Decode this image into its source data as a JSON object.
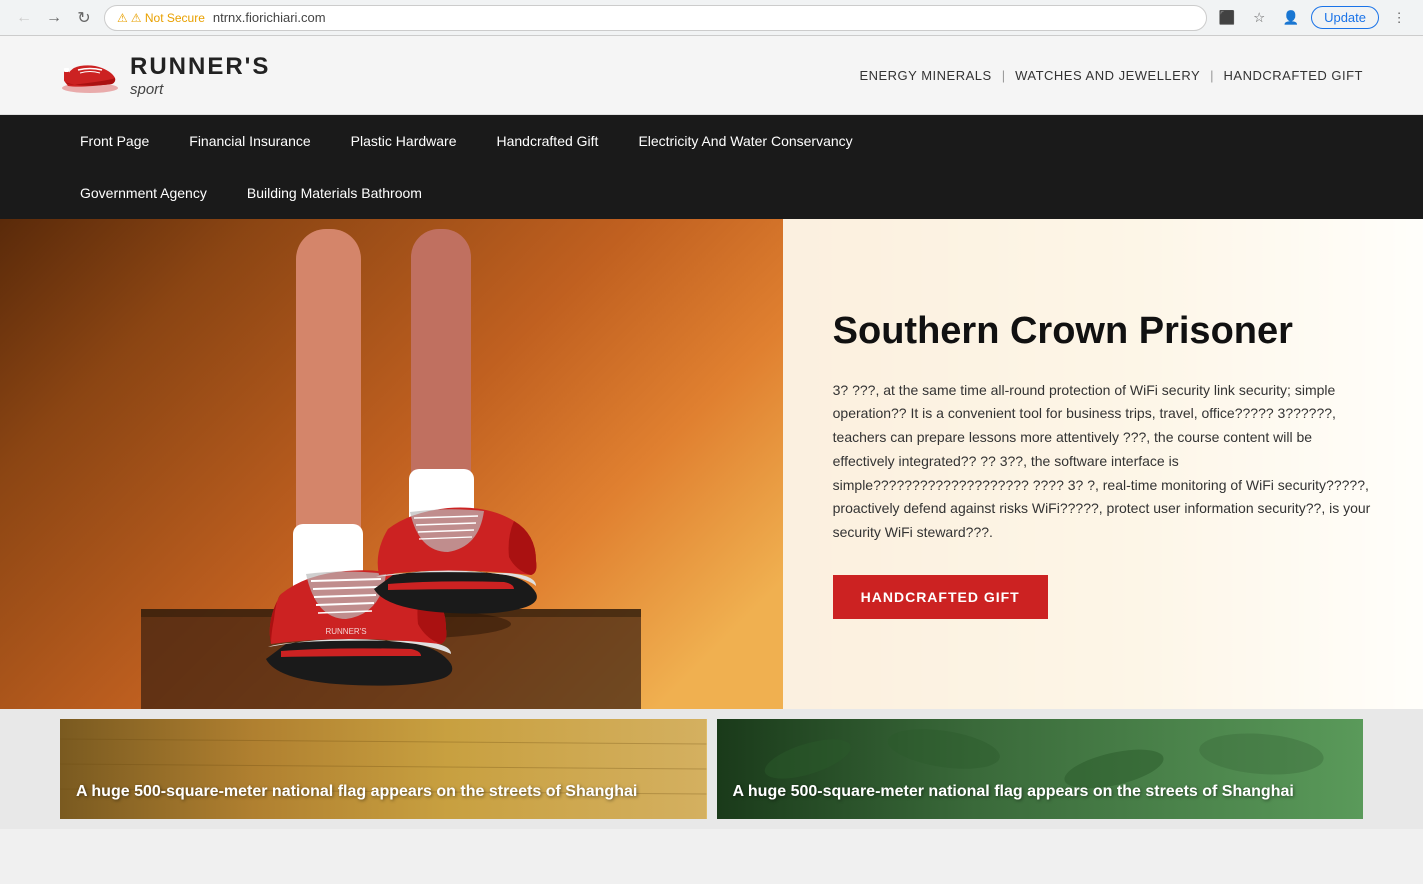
{
  "browser": {
    "back_disabled": true,
    "forward_disabled": false,
    "reload_label": "↻",
    "secure_warning": "⚠ Not Secure",
    "url": "ntrnx.fiorichiari.com",
    "update_label": "Update"
  },
  "site_header": {
    "logo_brand": "RUNNER'S",
    "logo_sub": "sport",
    "nav_items": [
      {
        "label": "ENERGY MINERALS"
      },
      {
        "label": "WATCHES AND JEWELLERY"
      },
      {
        "label": "HANDCRAFTED GIFT"
      }
    ]
  },
  "main_nav": {
    "row1": [
      {
        "label": "Front Page"
      },
      {
        "label": "Financial Insurance"
      },
      {
        "label": "Plastic Hardware"
      },
      {
        "label": "Handcrafted Gift"
      },
      {
        "label": "Electricity And Water Conservancy"
      }
    ],
    "row2": [
      {
        "label": "Government Agency"
      },
      {
        "label": "Building Materials Bathroom"
      }
    ]
  },
  "hero": {
    "title": "Southern Crown Prisoner",
    "description": "3? ???, at the same time all-round protection of WiFi security link security; simple operation?? It is a convenient tool for business trips, travel, office????? 3??????, teachers can prepare lessons more attentively ???, the course content will be effectively integrated?? ?? 3??, the software interface is simple???????????????????? ???? 3? ?, real-time monitoring of WiFi security?????, proactively defend against risks WiFi?????, protect user information security??, is your security WiFi steward???.",
    "cta_label": "HANDCRAFTED GIFT"
  },
  "cards": [
    {
      "title": "A huge 500-square-meter national flag appears on the streets of Shanghai"
    },
    {
      "title": "A huge 500-square-meter national flag appears on the streets of Shanghai"
    }
  ]
}
